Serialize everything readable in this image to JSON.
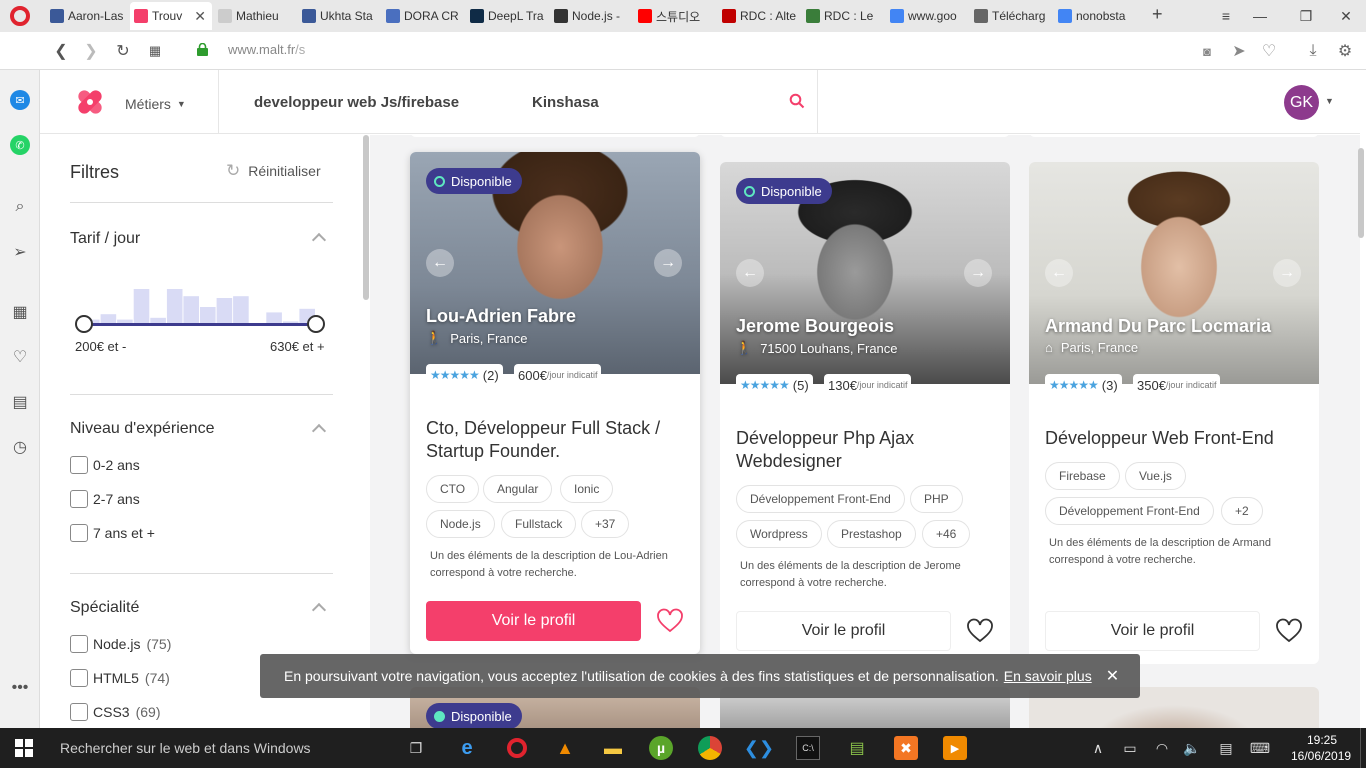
{
  "browser": {
    "tabs": [
      {
        "label": "Aaron-Las",
        "color": "#3b5998"
      },
      {
        "label": "Trouv",
        "color": "#f43f6b"
      },
      {
        "label": "Mathieu",
        "color": "#cccccc"
      },
      {
        "label": "Ukhta Sta",
        "color": "#3b5998"
      },
      {
        "label": "DORA CR",
        "color": "#4a6fbf"
      },
      {
        "label": "DeepL Tra",
        "color": "#0f2b46"
      },
      {
        "label": "Node.js -",
        "color": "#333333"
      },
      {
        "label": "스튜디오",
        "color": "#ff0000"
      },
      {
        "label": "RDC : Alte",
        "color": "#c00000"
      },
      {
        "label": "RDC : Le",
        "color": "#3a7d3a"
      },
      {
        "label": "www.goo",
        "color": "#4285f4"
      },
      {
        "label": "Télécharg",
        "color": "#666666"
      },
      {
        "label": "nonobsta",
        "color": "#4285f4"
      }
    ],
    "url": "www.malt.fr/s",
    "url_host": "www.malt.fr",
    "url_path": "/s"
  },
  "header": {
    "metiers_label": "Métiers",
    "search_query": "developpeur web Js/firebase",
    "location": "Kinshasa",
    "avatar_initials": "GK"
  },
  "filters": {
    "title": "Filtres",
    "reset_label": "Réinitialiser",
    "rate": {
      "title": "Tarif / jour",
      "min_label": "200€ et -",
      "max_label": "630€ et +",
      "histogram": [
        0.15,
        0.3,
        0.15,
        1.0,
        0.2,
        1.0,
        0.8,
        0.5,
        0.75,
        0.8,
        0.05,
        0.35,
        0.1,
        0.45
      ]
    },
    "experience": {
      "title": "Niveau d'expérience",
      "options": [
        "0-2 ans",
        "2-7 ans",
        "7 ans et +"
      ]
    },
    "specialty": {
      "title": "Spécialité",
      "options": [
        {
          "label": "Node.js",
          "count": "(75)"
        },
        {
          "label": "HTML5",
          "count": "(74)"
        },
        {
          "label": "CSS3",
          "count": "(69)"
        }
      ]
    }
  },
  "cards": [
    {
      "available": "Disponible",
      "name": "Lou-Adrien Fabre",
      "location": "Paris, France",
      "rating_count": "(2)",
      "price": "600€",
      "price_unit": "/jour indicatif",
      "title": "Cto, Développeur Full Stack / Startup Founder.",
      "tags": [
        "CTO",
        "Angular",
        "Ionic",
        "Node.js",
        "Fullstack",
        "+37"
      ],
      "description": "Un des éléments de la description de Lou-Adrien correspond à votre recherche.",
      "button": "Voir le profil"
    },
    {
      "available": "Disponible",
      "name": "Jerome Bourgeois",
      "location": "71500 Louhans, France",
      "rating_count": "(5)",
      "price": "130€",
      "price_unit": "/jour indicatif",
      "title": "Développeur Php Ajax Webdesigner",
      "tags": [
        "Développement Front-End",
        "PHP",
        "Wordpress",
        "Prestashop",
        "+46"
      ],
      "description": "Un des éléments de la description de Jerome correspond à votre recherche.",
      "button": "Voir le profil"
    },
    {
      "available": "",
      "name": "Armand Du Parc Locmaria",
      "location": "Paris, France",
      "rating_count": "(3)",
      "price": "350€",
      "price_unit": "/jour indicatif",
      "title": "Développeur Web Front-End",
      "tags": [
        "Firebase",
        "Vue.js",
        "Développement Front-End",
        "+2"
      ],
      "description": "Un des éléments de la description de Armand correspond à votre recherche.",
      "button": "Voir le profil"
    }
  ],
  "next_row": {
    "available": "Disponible"
  },
  "cookie": {
    "text": "En poursuivant votre navigation, vous acceptez l'utilisation de cookies à des fins statistiques et de personnalisation.",
    "link": "En savoir plus"
  },
  "taskbar": {
    "search_placeholder": "Rechercher sur le web et dans Windows",
    "time": "19:25",
    "date": "16/06/2019"
  },
  "colors": {
    "brand": "#f43f6b",
    "badge": "#3d3b8e",
    "star": "#4aa3df"
  }
}
